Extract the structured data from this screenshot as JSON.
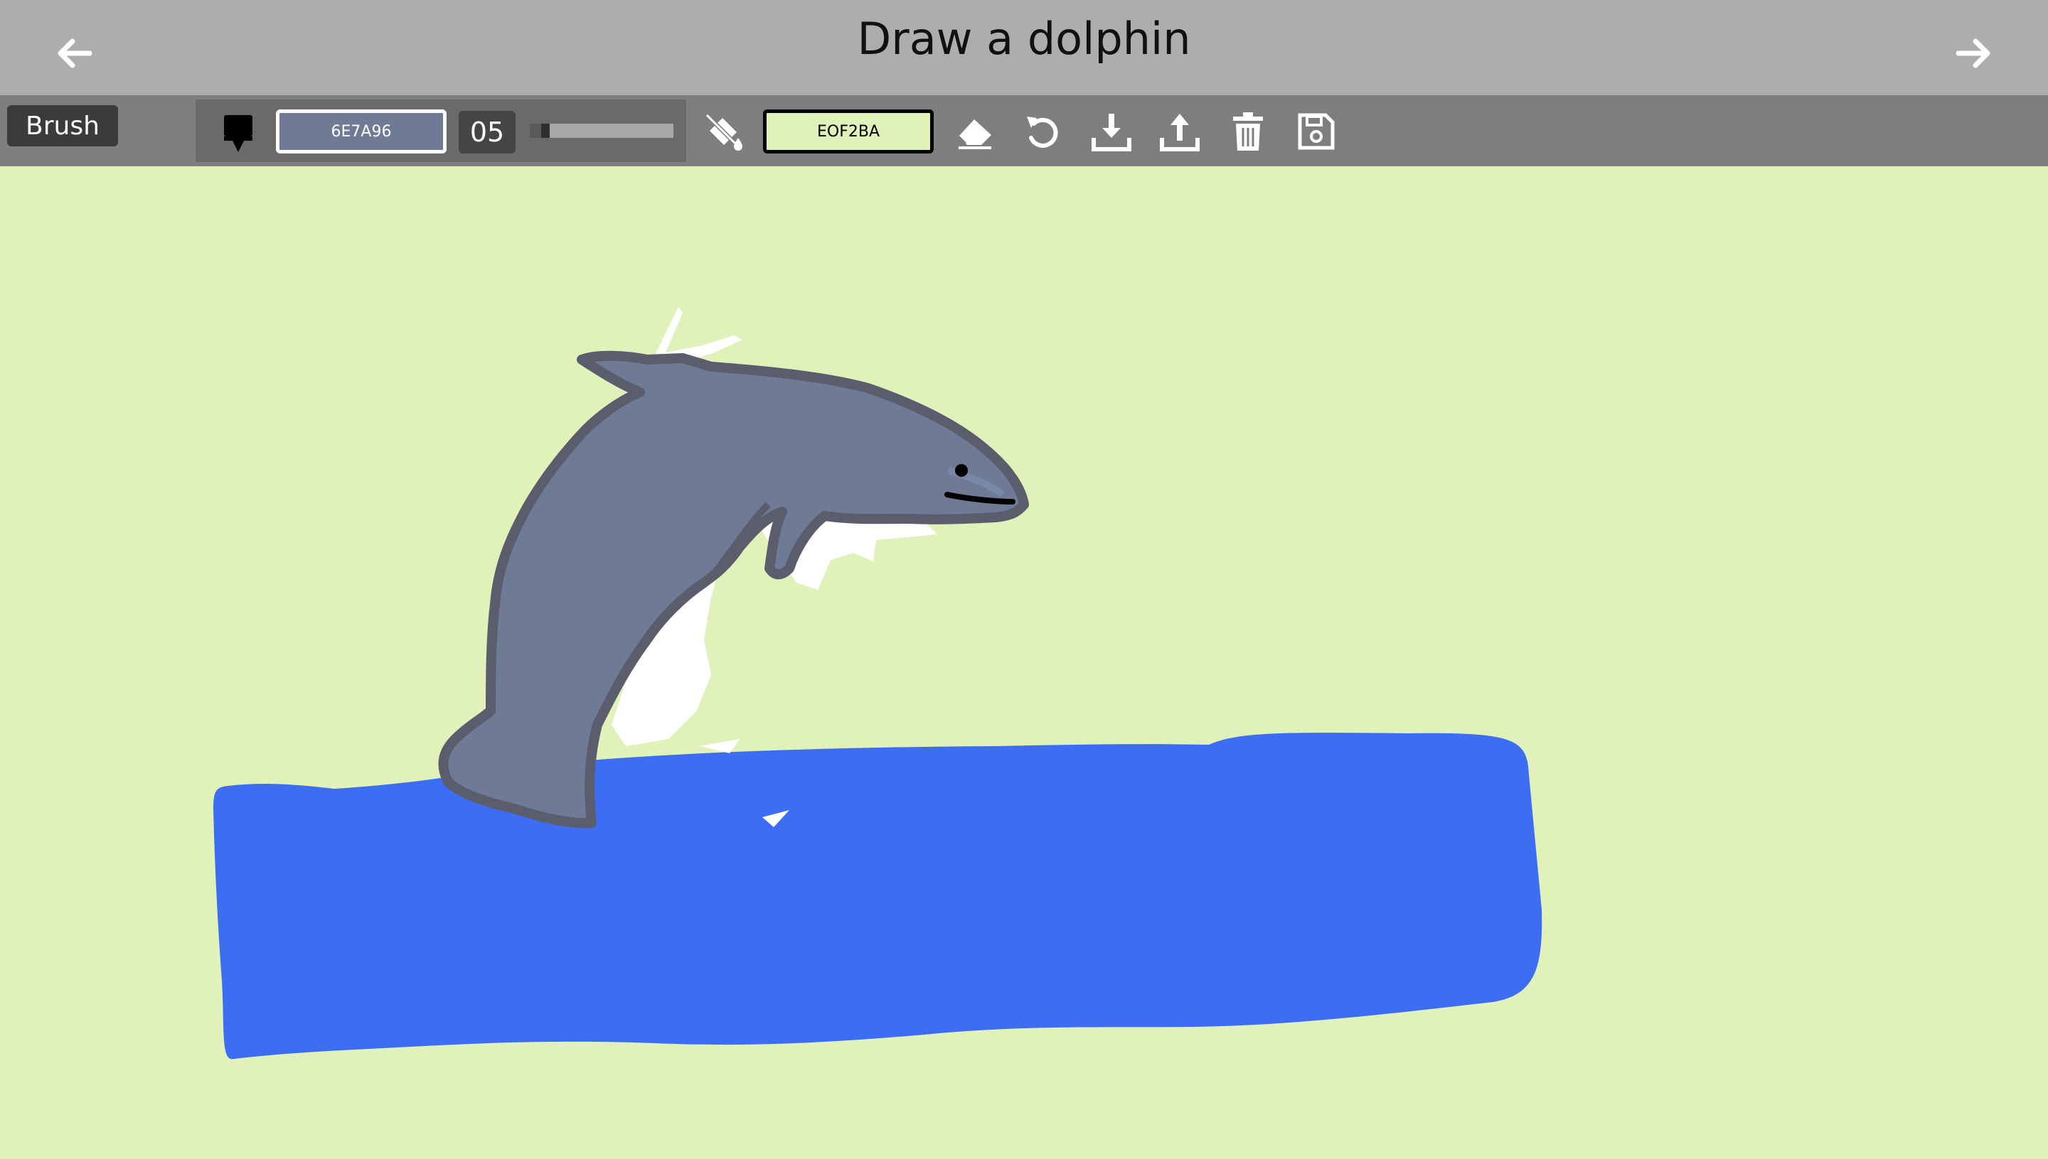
{
  "header": {
    "title": "Draw a dolphin",
    "back_icon": "arrow-left-icon",
    "forward_icon": "arrow-right-icon"
  },
  "toolbar": {
    "mode_label": "Brush",
    "brush_icon": "brush-icon",
    "brush_color_hex": "6E7A96",
    "brush_size": "05",
    "brush_size_value": 5,
    "fill_icon": "paint-bucket-icon",
    "fill_color_hex": "EOF2BA",
    "tools": [
      "eraser-icon",
      "undo-icon",
      "download-icon",
      "upload-icon",
      "trash-icon",
      "save-icon"
    ]
  },
  "colors": {
    "titlebar": "#ADADAD",
    "toolbar": "#7E7E7E",
    "canvas_background": "#E0F2BA",
    "brush_color": "#6E7A96",
    "dolphin_outline": "#5A5E6C",
    "water": "#3D6DF2",
    "splash": "#FFFFFF"
  }
}
